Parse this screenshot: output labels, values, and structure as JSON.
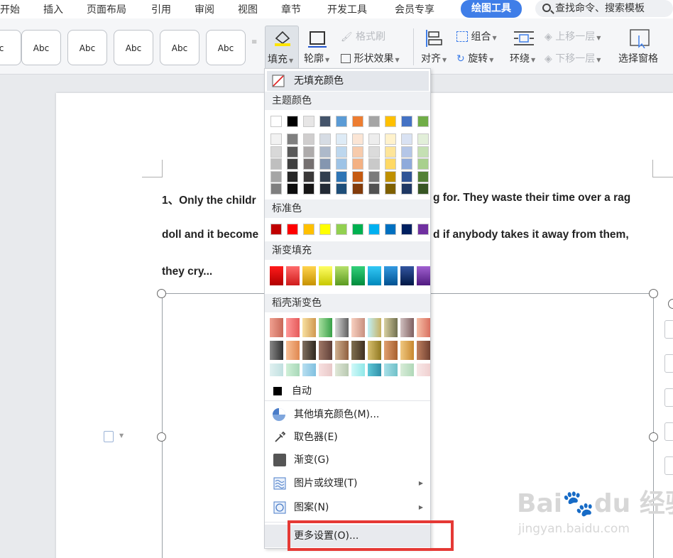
{
  "tabs": [
    {
      "label": "开始"
    },
    {
      "label": "插入"
    },
    {
      "label": "页面布局"
    },
    {
      "label": "引用"
    },
    {
      "label": "审阅"
    },
    {
      "label": "视图"
    },
    {
      "label": "章节"
    },
    {
      "label": "开发工具"
    },
    {
      "label": "会员专享"
    },
    {
      "label": "绘图工具"
    }
  ],
  "search": {
    "label": "查找命令、搜索模板"
  },
  "ribbon": {
    "styles": [
      "c",
      "Abc",
      "Abc",
      "Abc",
      "Abc",
      "Abc"
    ],
    "fill": "填充",
    "outline": "轮廓",
    "format_painter": "格式刷",
    "shape_effect": "形状效果",
    "align": "对齐",
    "group": "组合",
    "rotate": "旋转",
    "wrap": "环绕",
    "bring_forward": "上移一层",
    "send_backward": "下移一层",
    "selection_pane": "选择窗格"
  },
  "document": {
    "line1_left": "1、Only the childr",
    "line1_right": "g for. They waste their time over a rag",
    "line2_left": "doll and it become",
    "line2_right": "d if anybody takes it away from them,",
    "line3": "they cry..."
  },
  "menu": {
    "no_fill": "无填充颜色",
    "theme_colors": "主题颜色",
    "standard_colors": "标准色",
    "gradient_fill": "渐变填充",
    "daoke_gradient": "稻壳渐变色",
    "auto": "自动",
    "more_fill_colors": "其他填充颜色(M)...",
    "eyedropper": "取色器(E)",
    "gradient": "渐变(G)",
    "picture_texture": "图片或纹理(T)",
    "pattern": "图案(N)",
    "more_settings": "更多设置(O)..."
  },
  "colors": {
    "accent": "#3f7ee8",
    "highlight_box": "#e53935",
    "theme_top": [
      "#ffffff",
      "#000000",
      "#e7e6e6",
      "#44546a",
      "#5b9bd5",
      "#ed7d31",
      "#a5a5a5",
      "#ffc000",
      "#4472c4",
      "#70ad47"
    ],
    "theme_shades": [
      [
        "#f2f2f2",
        "#7f7f7f",
        "#d0cece",
        "#d6dce4",
        "#deebf6",
        "#fbe5d5",
        "#ededed",
        "#fff2cc",
        "#d9e2f3",
        "#e2efd9"
      ],
      [
        "#d8d8d8",
        "#595959",
        "#aeabab",
        "#adb9ca",
        "#bdd7ee",
        "#f7cbac",
        "#dbdbdb",
        "#fee599",
        "#b4c6e7",
        "#c5e0b3"
      ],
      [
        "#bfbfbf",
        "#3f3f3f",
        "#757070",
        "#8496b0",
        "#9dc3e6",
        "#f4b183",
        "#c9c9c9",
        "#ffd965",
        "#8eaadb",
        "#a8d08d"
      ],
      [
        "#a5a5a5",
        "#262626",
        "#3a3838",
        "#323f4f",
        "#2e75b5",
        "#c55a11",
        "#7b7b7b",
        "#bf9000",
        "#2f5496",
        "#538135"
      ],
      [
        "#7f7f7f",
        "#0c0c0c",
        "#171616",
        "#222a35",
        "#1e4e79",
        "#833c0b",
        "#525252",
        "#7f6000",
        "#1f3864",
        "#375623"
      ]
    ],
    "standard": [
      "#c00000",
      "#ff0000",
      "#ffc000",
      "#ffff00",
      "#92d050",
      "#00b050",
      "#00b0f0",
      "#0070c0",
      "#002060",
      "#7030a0"
    ],
    "gradient_fill": [
      [
        "#ff1a1a",
        "#b00000"
      ],
      [
        "#ff6b6b",
        "#d01a1a"
      ],
      [
        "#ffd34d",
        "#c79200"
      ],
      [
        "#ffff66",
        "#c8c800"
      ],
      [
        "#b5e06a",
        "#5a9a20"
      ],
      [
        "#33d07a",
        "#008a3c"
      ],
      [
        "#33c8f5",
        "#0088bb"
      ],
      [
        "#3399e0",
        "#00508f"
      ],
      [
        "#3355a0",
        "#001845"
      ],
      [
        "#a060d0",
        "#501a80"
      ]
    ],
    "daoke": [
      [
        [
          "#f0a090",
          "#c86858"
        ],
        [
          "#ff9a9a",
          "#e55a5a"
        ],
        [
          "#f8e0a0",
          "#d09850"
        ],
        [
          "#a8e0a0",
          "#38a048"
        ],
        [
          "#d8d8d8",
          "#606060"
        ],
        [
          "#f8d0c0",
          "#c89080"
        ],
        [
          "#c0f0f8",
          "#c8b060"
        ],
        [
          "#d8d0a0",
          "#707050"
        ],
        [
          "#d0c0c0",
          "#806060"
        ],
        [
          "#f8c0a8",
          "#d87060"
        ]
      ],
      [
        [
          "#888888",
          "#303030"
        ],
        [
          "#f8c098",
          "#e08850"
        ],
        [
          "#807060",
          "#302820"
        ],
        [
          "#a07868",
          "#604038"
        ],
        [
          "#d0b090",
          "#906040"
        ],
        [
          "#807050",
          "#403020"
        ],
        [
          "#d8c070",
          "#907820"
        ],
        [
          "#e0a070",
          "#a86030"
        ],
        [
          "#f0c880",
          "#c88830"
        ],
        [
          "#c08060",
          "#704030"
        ]
      ],
      [
        [
          "#e0f0f0",
          "#c0e0e0"
        ],
        [
          "#d0f0d8",
          "#a8d8b8"
        ],
        [
          "#b8dff0",
          "#80c0e0"
        ],
        [
          "#f8e0e0",
          "#e8c8c8"
        ],
        [
          "#e0e8d8",
          "#b8c8b0"
        ],
        [
          "#d0f8f8",
          "#90e8e8"
        ],
        [
          "#60c8d8",
          "#3090a8"
        ],
        [
          "#a8e0e8",
          "#70c0c8"
        ],
        [
          "#d8ecd8",
          "#b0d8b8"
        ],
        [
          "#f8e8e8",
          "#f0d0d0"
        ]
      ]
    ]
  }
}
